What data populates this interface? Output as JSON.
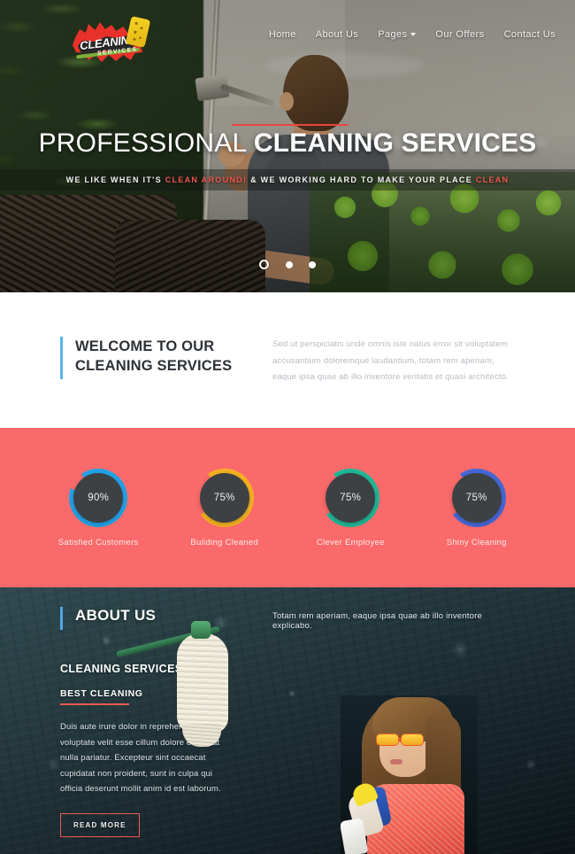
{
  "site": {
    "logo": {
      "line1": "CLEANING",
      "line2": "SERVICES",
      "sponge_icon": "sponge-icon",
      "splash_color": "#e8312a",
      "accent_green": "#7fae3a"
    },
    "nav": [
      {
        "label": "Home",
        "has_dropdown": false
      },
      {
        "label": "About Us",
        "has_dropdown": false
      },
      {
        "label": "Pages",
        "has_dropdown": true
      },
      {
        "label": "Our Offers",
        "has_dropdown": false
      },
      {
        "label": "Contact Us",
        "has_dropdown": false
      }
    ]
  },
  "hero": {
    "heading_light": "PROFESSIONAL ",
    "heading_bold": "CLEANING SERVICES",
    "sub_part1": "WE LIKE WHEN IT'S ",
    "sub_highlight1": "CLEAN AROUND!",
    "sub_part2": " & WE WORKING HARD TO MAKE YOUR PLACE ",
    "sub_highlight2": "CLEAN",
    "slider_dots": [
      {
        "active": true
      },
      {
        "active": false
      },
      {
        "active": false
      }
    ],
    "accent_color": "#e8453c"
  },
  "welcome": {
    "title": "WELCOME TO OUR\nCLEANING SERVICES",
    "title_line1": "WELCOME TO OUR",
    "title_line2": "CLEANING SERVICES",
    "paragraph": "Sed ut perspiciatis unde omnis iste natus error sit voluptatem accusantium doloremque laudantium, totam rem aperiam, eaque ipsa quae ab illo inventore veritatis et quasi architecto.",
    "accent_color": "#58b4ea"
  },
  "counters": {
    "background_color": "#fb6a6a",
    "items": [
      {
        "percent": "90%",
        "value": 90,
        "label": "Satisfied Customers",
        "color": "#23a3e8"
      },
      {
        "percent": "75%",
        "value": 75,
        "label": "Building Cleaned",
        "color": "#f5b220"
      },
      {
        "percent": "75%",
        "value": 75,
        "label": "Clever Employee",
        "color": "#1fb898"
      },
      {
        "percent": "75%",
        "value": 75,
        "label": "Shiny Cleaning",
        "color": "#4668d6"
      }
    ]
  },
  "about": {
    "title": "ABOUT US",
    "lead": "Totam rem aperiam, eaque ipsa quae ab illo inventore explicabo.",
    "subtitle": "CLEANING SERVICES",
    "tagline": "BEST CLEANING",
    "paragraph": "Duis aute irure dolor in reprehenderit in voluptate velit esse cillum dolore eu fugiat nulla pariatur. Excepteur sint occaecat cupidatat non proident, sunt in culpa qui officia deserunt mollit anim id est laborum.",
    "button_label": "READ MORE",
    "accent_color": "#4ea8e8",
    "button_border_color": "#ef5a52"
  }
}
